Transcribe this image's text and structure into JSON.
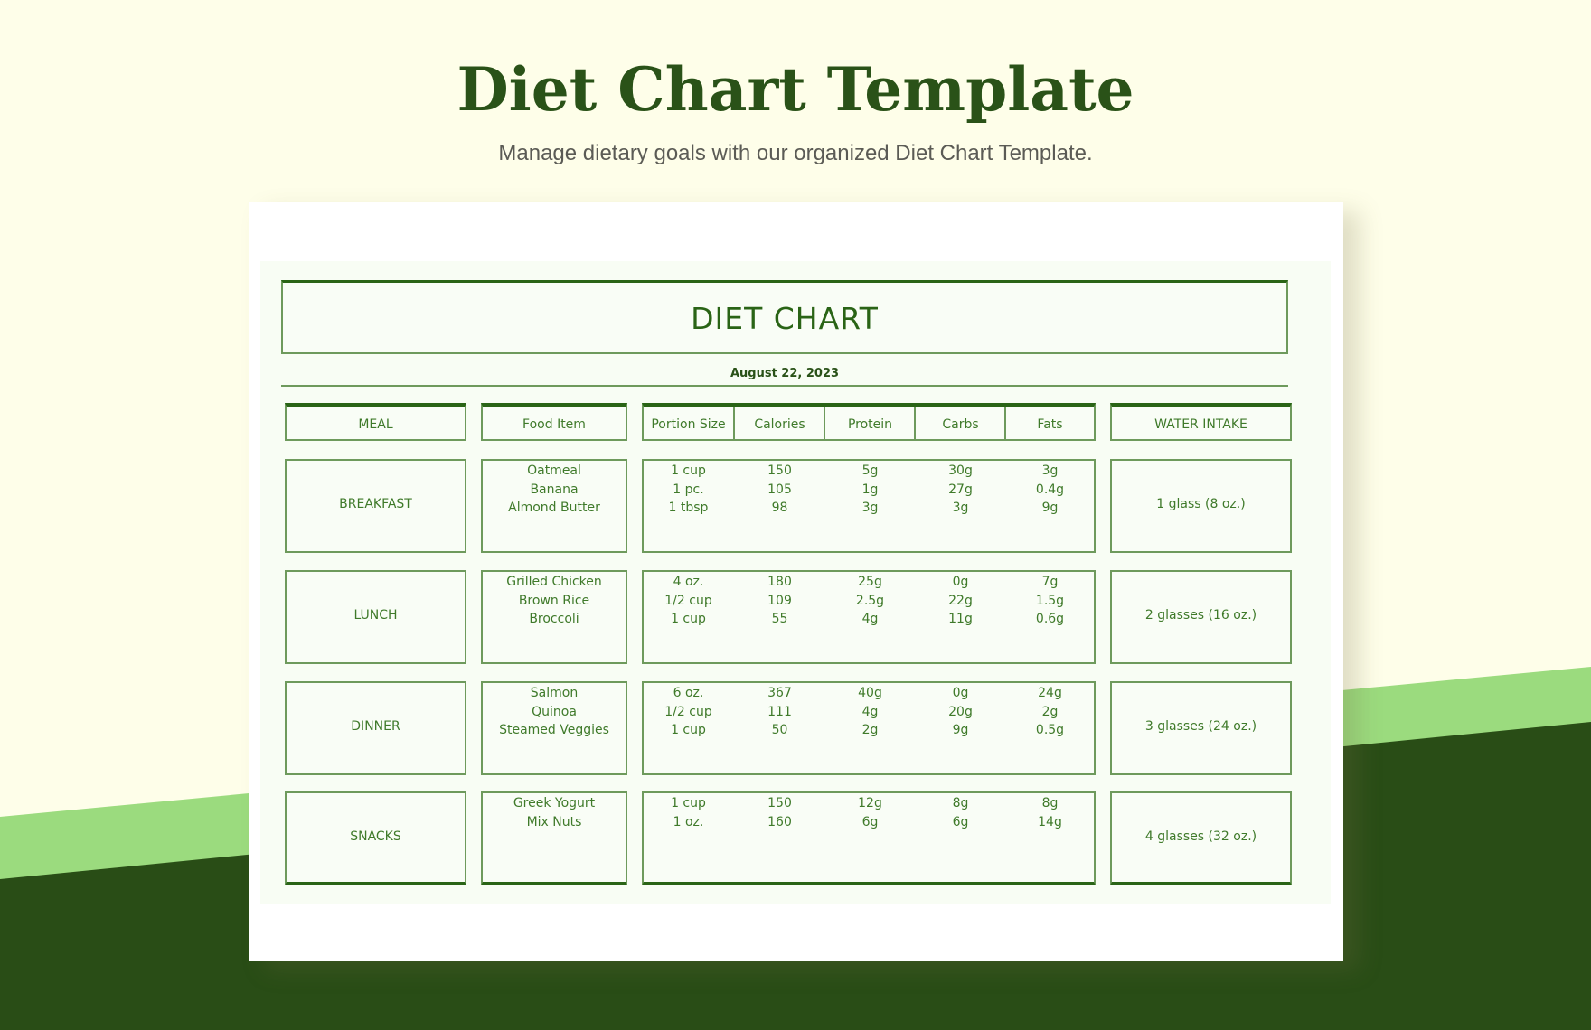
{
  "header": {
    "title": "Diet Chart Template",
    "subtitle": "Manage dietary goals with our organized Diet Chart Template."
  },
  "colors": {
    "background": "#fefee9",
    "band_light": "#9bdb7e",
    "band_dark": "#294d16",
    "accent": "#2a6416",
    "text": "#3f7a2a"
  },
  "chart": {
    "title": "DIET CHART",
    "date": "August 22, 2023",
    "headers": {
      "meal": "MEAL",
      "food": "Food Item",
      "nutrition": [
        "Portion Size",
        "Calories",
        "Protein",
        "Carbs",
        "Fats"
      ],
      "water": "WATER INTAKE"
    },
    "rows": [
      {
        "meal": "BREAKFAST",
        "foods": [
          "Oatmeal",
          "Banana",
          "Almond Butter"
        ],
        "portion": [
          "1 cup",
          "1 pc.",
          "1 tbsp"
        ],
        "calories": [
          "150",
          "105",
          "98"
        ],
        "protein": [
          "5g",
          "1g",
          "3g"
        ],
        "carbs": [
          "30g",
          "27g",
          "3g"
        ],
        "fats": [
          "3g",
          "0.4g",
          "9g"
        ],
        "water": "1 glass (8 oz.)"
      },
      {
        "meal": "LUNCH",
        "foods": [
          "Grilled Chicken",
          "Brown Rice",
          "Broccoli"
        ],
        "portion": [
          "4 oz.",
          "1/2 cup",
          "1 cup"
        ],
        "calories": [
          "180",
          "109",
          "55"
        ],
        "protein": [
          "25g",
          "2.5g",
          "4g"
        ],
        "carbs": [
          "0g",
          "22g",
          "11g"
        ],
        "fats": [
          "7g",
          "1.5g",
          "0.6g"
        ],
        "water": "2 glasses (16 oz.)"
      },
      {
        "meal": "DINNER",
        "foods": [
          "Salmon",
          "Quinoa",
          "Steamed Veggies"
        ],
        "portion": [
          "6 oz.",
          "1/2 cup",
          "1 cup"
        ],
        "calories": [
          "367",
          "111",
          "50"
        ],
        "protein": [
          "40g",
          "4g",
          "2g"
        ],
        "carbs": [
          "0g",
          "20g",
          "9g"
        ],
        "fats": [
          "24g",
          "2g",
          "0.5g"
        ],
        "water": "3 glasses (24 oz.)"
      },
      {
        "meal": "SNACKS",
        "foods": [
          "Greek Yogurt",
          "Mix Nuts"
        ],
        "portion": [
          "1 cup",
          "1 oz."
        ],
        "calories": [
          "150",
          "160"
        ],
        "protein": [
          "12g",
          "6g"
        ],
        "carbs": [
          "8g",
          "6g"
        ],
        "fats": [
          "8g",
          "14g"
        ],
        "water": "4 glasses (32 oz.)"
      }
    ]
  }
}
